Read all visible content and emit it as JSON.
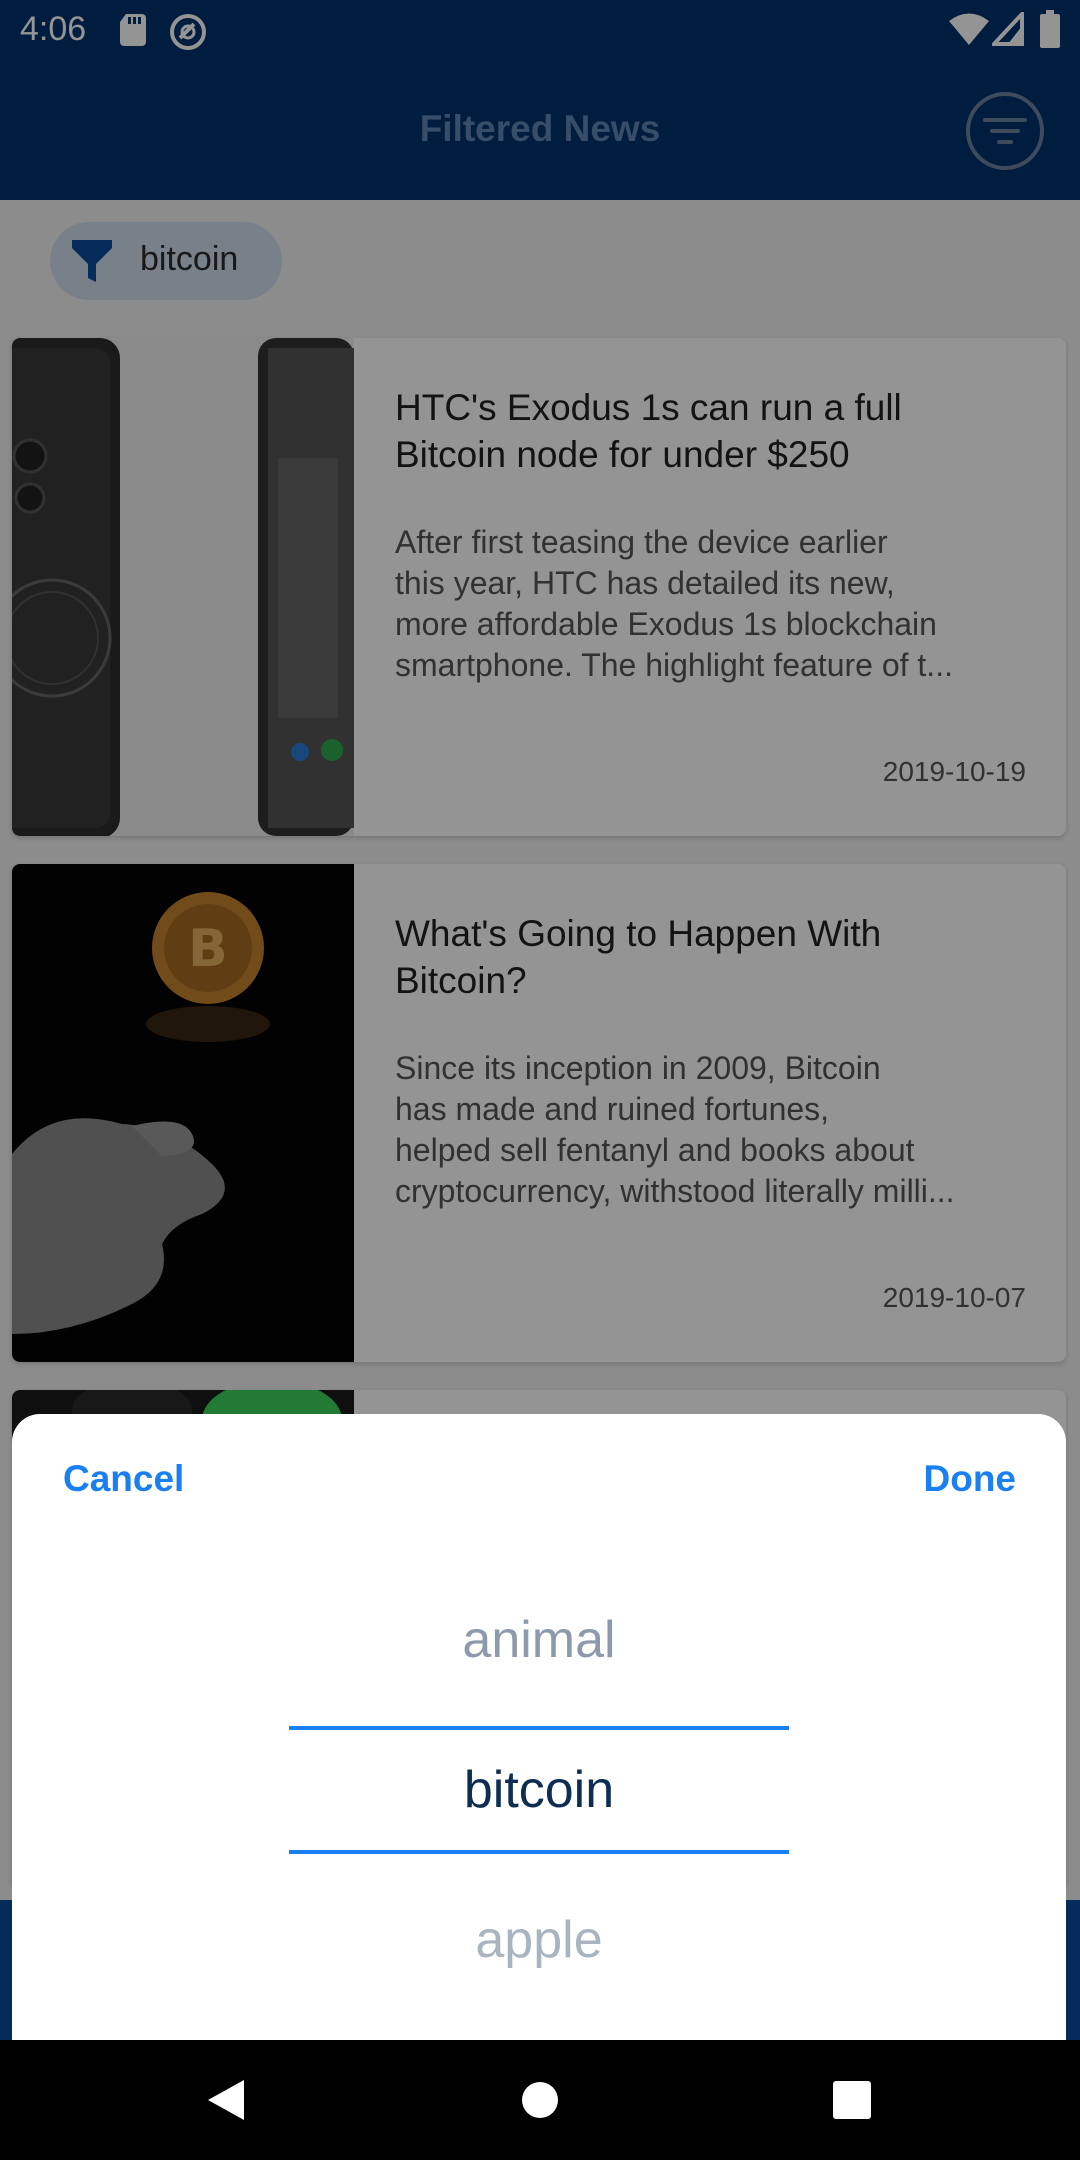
{
  "status_bar": {
    "time": "4:06",
    "icons": [
      "sd-card-icon",
      "sync-circle-icon",
      "wifi-icon",
      "signal-icon",
      "battery-icon"
    ]
  },
  "app_bar": {
    "title": "Filtered News",
    "filter_icon": "filter-list-icon"
  },
  "filter_chip": {
    "icon": "funnel-icon",
    "label": "bitcoin"
  },
  "articles": [
    {
      "title": "HTC's Exodus 1s can run a full Bitcoin node for under $250",
      "title_lines": [
        "HTC's Exodus 1s can run a full",
        "Bitcoin node for under $250"
      ],
      "description_lines": [
        "After first teasing the device earlier",
        "this year, HTC has detailed its new,",
        "more affordable Exodus 1s blockchain",
        "smartphone. The highlight feature of t..."
      ],
      "date": "2019-10-19",
      "image": "htc-exodus-phone-image"
    },
    {
      "title": "What's Going to Happen With Bitcoin?",
      "title_lines": [
        "What's Going to Happen With",
        "Bitcoin?"
      ],
      "description_lines": [
        "Since its inception in 2009, Bitcoin",
        "has made and ruined fortunes,",
        "helped sell fentanyl and books about",
        "cryptocurrency, withstood literally milli..."
      ],
      "date": "2019-10-07",
      "image": "bitcoin-coin-flip-image"
    }
  ],
  "picker_sheet": {
    "cancel_label": "Cancel",
    "done_label": "Done",
    "options": [
      "animal",
      "bitcoin",
      "apple"
    ],
    "selected": "bitcoin",
    "accent_color": "#1a7ff0"
  },
  "colors": {
    "app_bar": "#01336f",
    "chip_bg": "#cfdcec",
    "accent": "#1a7ff0"
  },
  "nav_bar": {
    "icons": [
      "back-icon",
      "home-icon",
      "recents-icon"
    ]
  }
}
